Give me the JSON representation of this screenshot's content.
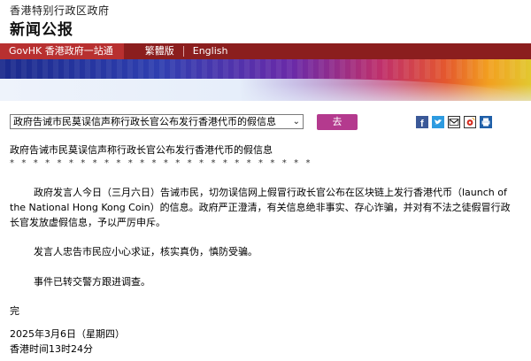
{
  "header": {
    "gov_name": "香港特别行政区政府",
    "site_title": "新闻公报"
  },
  "nav": {
    "items": [
      "GovHK 香港政府一站通",
      "繁體版",
      "English"
    ]
  },
  "toolbar": {
    "select_value": "政府告诫市民莫误信声称行政长官公布发行香港代币的假信息",
    "go_label": "去",
    "share_icons": [
      "facebook-icon",
      "twitter-icon",
      "email-icon",
      "weibo-icon",
      "print-icon"
    ]
  },
  "article": {
    "headline": "政府告诫市民莫误信声称行政长官公布发行香港代币的假信息",
    "stars": "* * * * * * * * * * * * * * * * * * * * * * * * * *",
    "p1_line1": "政府发言人今日（三月六日）告诫市民，切勿误信网上假冒行政长官公布在区块链上发行香港代币（launch of",
    "p1_line2": "the National Hong Kong Coin）的信息。政府严正澄清，有关信息绝非事实、存心诈骗，并对有不法之徒假冒行政",
    "p1_line3": "长官发放虚假信息，予以严厉申斥。",
    "p2": "发言人忠告市民应小心求证，核实真伪，慎防受骗。",
    "p3": "事件已转交警方跟进调查。",
    "end": "完",
    "date": "2025年3月6日（星期四）",
    "time": "香港时间13时24分"
  },
  "colors": {
    "nav_bg": "#8b1e1e",
    "go_button": "#b43a8e"
  }
}
